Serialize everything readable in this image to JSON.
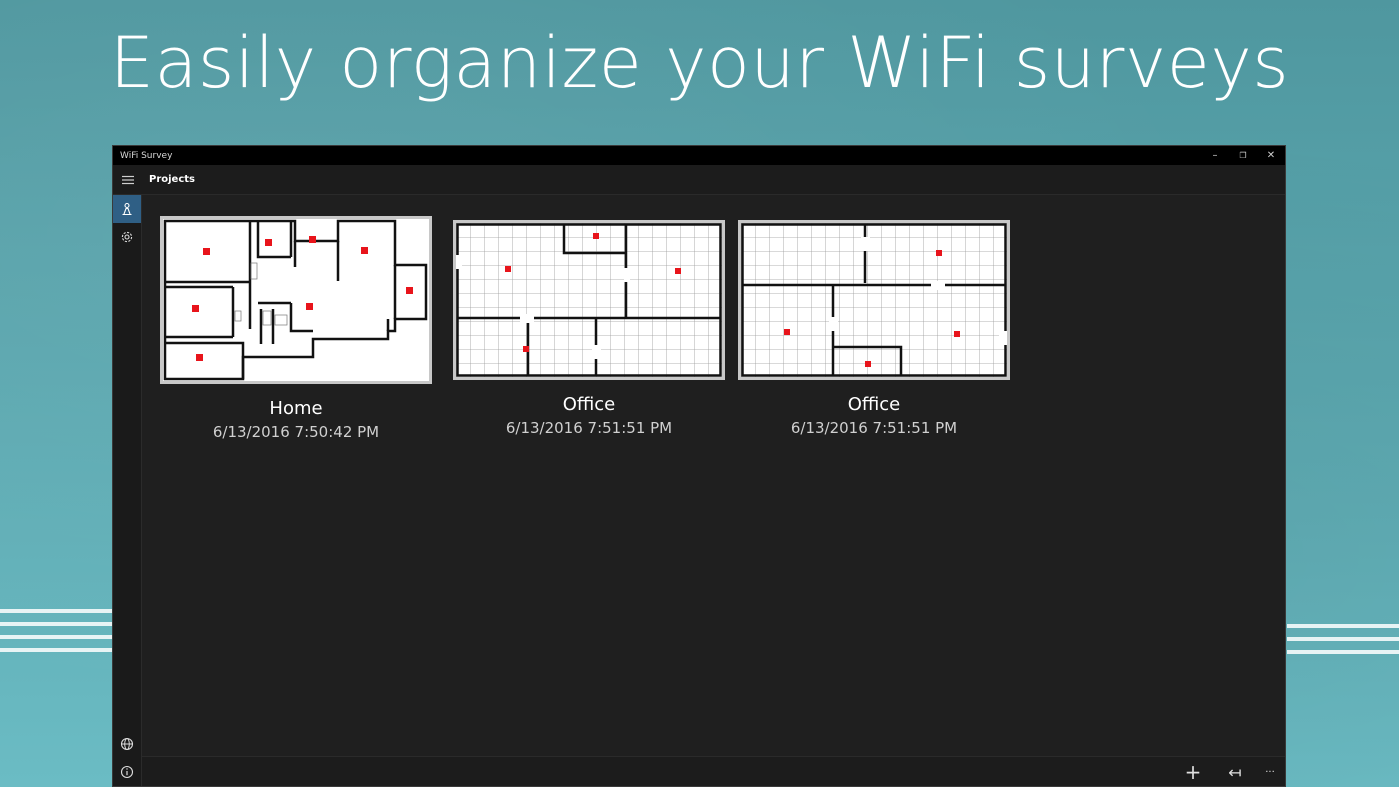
{
  "headline": "Easily organize your WiFi surveys",
  "window": {
    "title": "WiFi Survey",
    "controls": {
      "minimize": "–",
      "restore": "❐",
      "close": "✕"
    }
  },
  "appbar": {
    "title": "Projects"
  },
  "sidebar": {
    "top": [
      {
        "icon": "survey-person-icon",
        "active": true
      },
      {
        "icon": "gear-icon",
        "active": false
      }
    ],
    "bottom": [
      {
        "icon": "globe-icon"
      },
      {
        "icon": "info-icon"
      }
    ]
  },
  "projects": [
    {
      "name": "Home",
      "date": "6/13/2016 7:50:42 PM"
    },
    {
      "name": "Office",
      "date": "6/13/2016 7:51:51 PM"
    },
    {
      "name": "Office",
      "date": "6/13/2016 7:51:51 PM"
    }
  ],
  "commandbar": {
    "add": "+",
    "back": "↤",
    "more": "···"
  },
  "colors": {
    "accent": "#2f5f85",
    "survey_point": "#e8141b",
    "background": "#5aa6ae",
    "window": "#1f1f1f"
  }
}
